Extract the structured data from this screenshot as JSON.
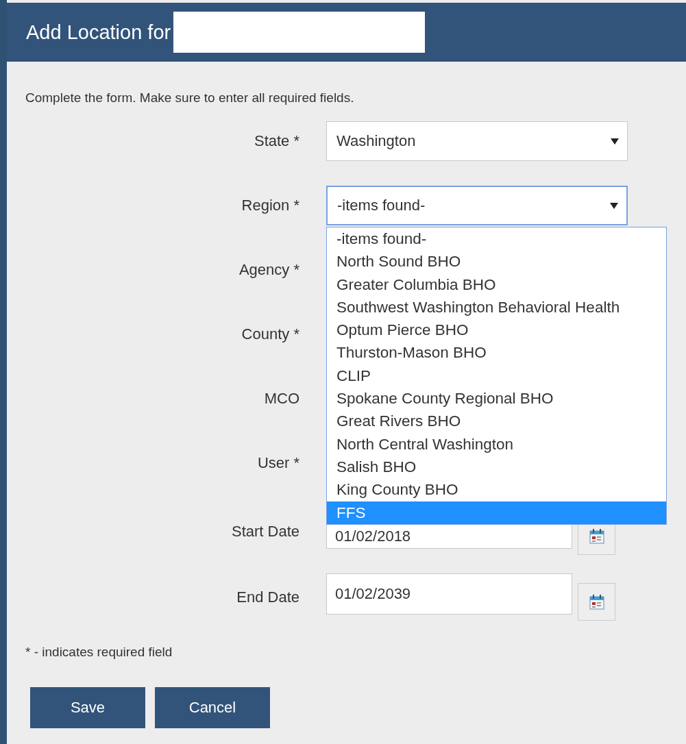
{
  "window": {
    "title": "Add Location for"
  },
  "instructions": "Complete the form. Make sure to enter all required fields.",
  "fields": [
    {
      "label": "State *",
      "kind": "select",
      "value": "Washington",
      "focused": false
    },
    {
      "label": "Region *",
      "kind": "select",
      "value": "-items found-",
      "focused": true,
      "expanded": true,
      "options": [
        {
          "label": "-items found-",
          "highlighted": false
        },
        {
          "label": "North Sound BHO",
          "highlighted": false
        },
        {
          "label": "Greater Columbia BHO",
          "highlighted": false
        },
        {
          "label": "Southwest Washington Behavioral Health",
          "highlighted": false
        },
        {
          "label": "Optum Pierce BHO",
          "highlighted": false
        },
        {
          "label": "Thurston-Mason BHO",
          "highlighted": false
        },
        {
          "label": "CLIP",
          "highlighted": false
        },
        {
          "label": "Spokane County Regional BHO",
          "highlighted": false
        },
        {
          "label": "Great Rivers BHO",
          "highlighted": false
        },
        {
          "label": "North Central Washington",
          "highlighted": false
        },
        {
          "label": "Salish BHO",
          "highlighted": false
        },
        {
          "label": "King County BHO",
          "highlighted": false
        },
        {
          "label": "FFS",
          "highlighted": true
        }
      ]
    },
    {
      "label": "Agency *",
      "kind": "covered"
    },
    {
      "label": "County *",
      "kind": "covered"
    },
    {
      "label": "MCO",
      "kind": "covered"
    },
    {
      "label": "User *",
      "kind": "covered"
    },
    {
      "label": "Start Date",
      "kind": "date",
      "value": "01/02/2018"
    },
    {
      "label": "End Date",
      "kind": "date",
      "value": "01/02/2039"
    }
  ],
  "footnote": "* - indicates required field",
  "buttons": [
    "Save",
    "Cancel"
  ]
}
